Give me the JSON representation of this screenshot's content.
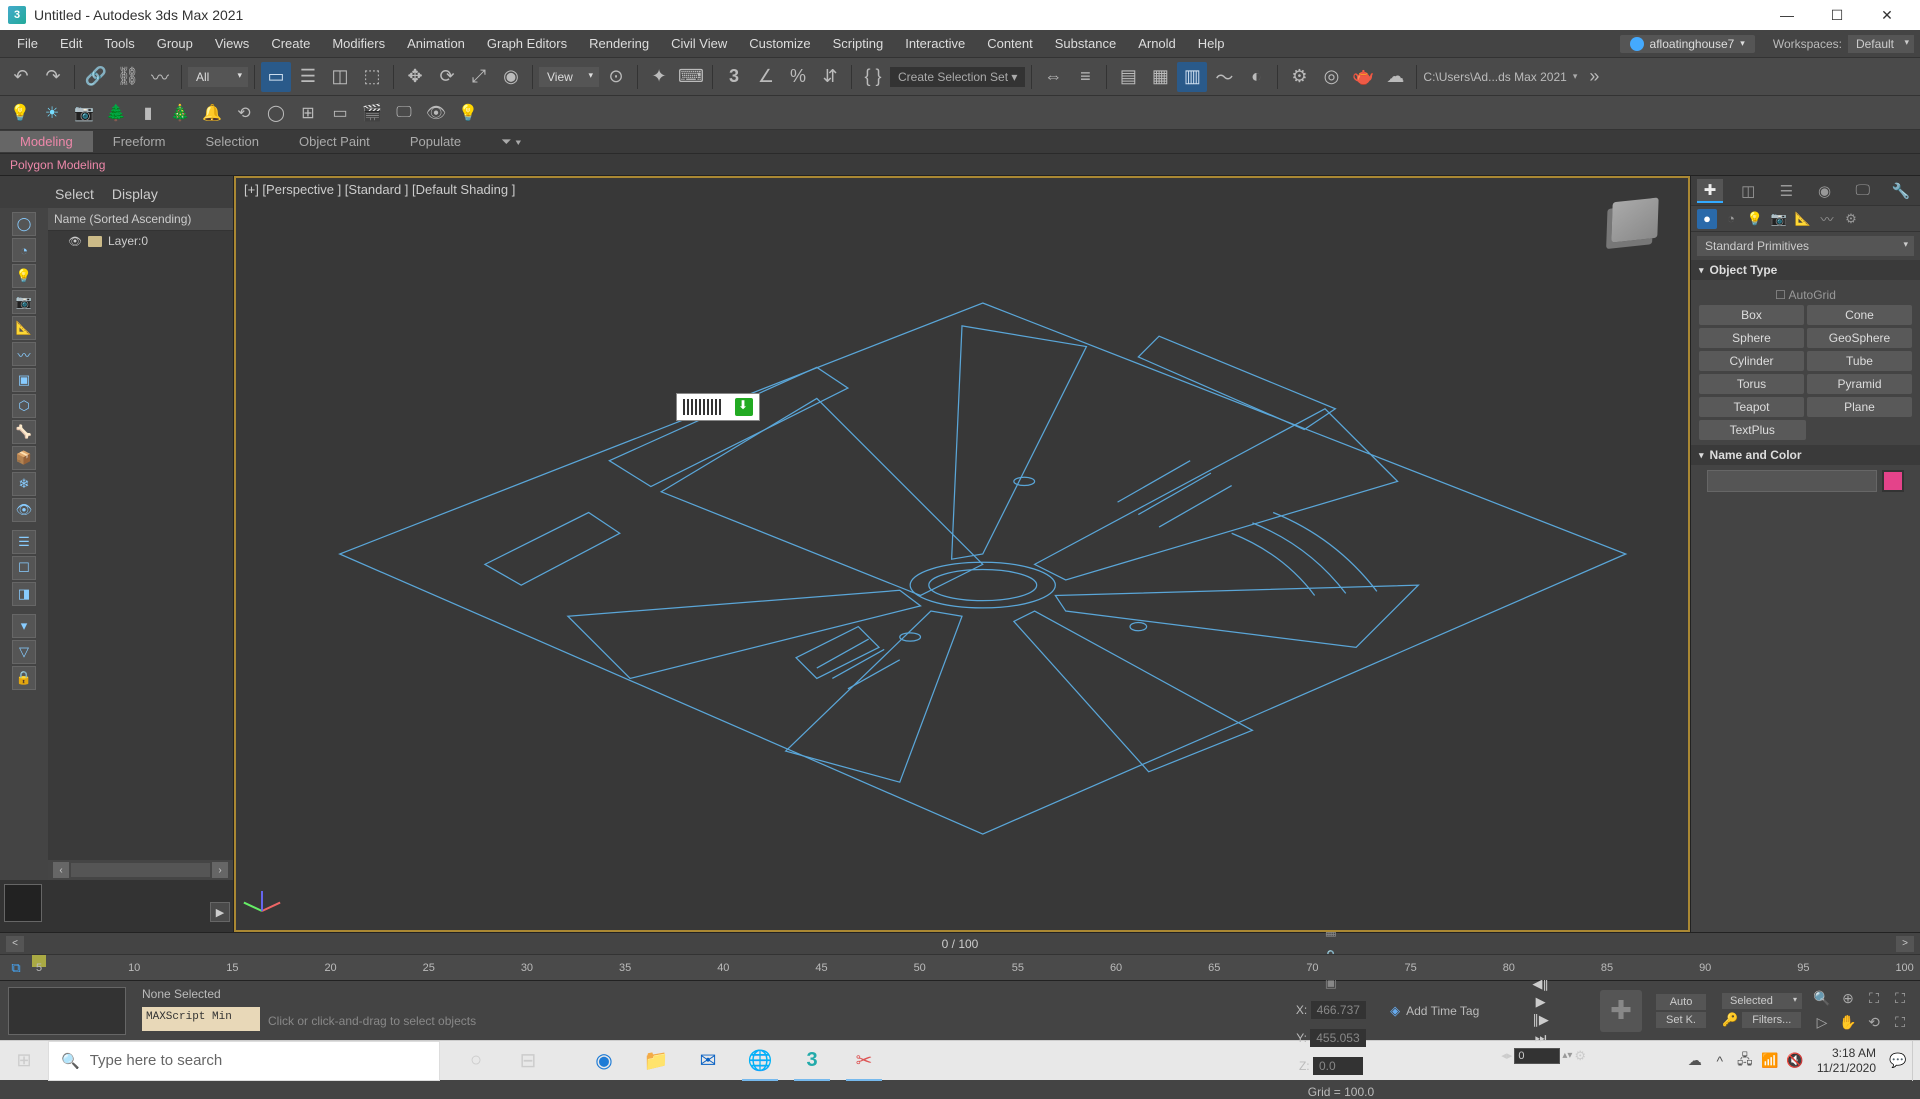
{
  "titlebar": {
    "title": "Untitled - Autodesk 3ds Max 2021"
  },
  "menu": {
    "items": [
      "File",
      "Edit",
      "Tools",
      "Group",
      "Views",
      "Create",
      "Modifiers",
      "Animation",
      "Graph Editors",
      "Rendering",
      "Civil View",
      "Customize",
      "Scripting",
      "Interactive",
      "Content",
      "Substance",
      "Arnold",
      "Help"
    ],
    "user": "afloatinghouse7",
    "workspaces_label": "Workspaces:",
    "workspace": "Default"
  },
  "toolbar": {
    "filter": "All",
    "refcoord": "View",
    "selset_placeholder": "Create Selection Set",
    "project_path": "C:\\Users\\Ad...ds Max 2021"
  },
  "ribbon": {
    "tabs": [
      "Modeling",
      "Freeform",
      "Selection",
      "Object Paint",
      "Populate"
    ],
    "sub": "Polygon Modeling"
  },
  "scene": {
    "tabs": [
      "Select",
      "Display"
    ],
    "header": "Name (Sorted Ascending)",
    "layer0": "Layer:0"
  },
  "viewport": {
    "label": "[+] [Perspective ] [Standard ] [Default Shading ]"
  },
  "cmdpanel": {
    "category": "Standard Primitives",
    "rollout_objtype": "Object Type",
    "autogrid": "AutoGrid",
    "buttons": [
      "Box",
      "Cone",
      "Sphere",
      "GeoSphere",
      "Cylinder",
      "Tube",
      "Torus",
      "Pyramid",
      "Teapot",
      "Plane",
      "TextPlus"
    ],
    "rollout_name": "Name and Color"
  },
  "time": {
    "frame": "0 / 100",
    "ticks": [
      "5",
      "10",
      "15",
      "20",
      "25",
      "30",
      "35",
      "40",
      "45",
      "50",
      "55",
      "60",
      "65",
      "70",
      "75",
      "80",
      "85",
      "90",
      "95",
      "100"
    ]
  },
  "status": {
    "sel": "None Selected",
    "prompt": "Click or click-and-drag to select objects",
    "maxscript": "MAXScript Min",
    "x": "466.737",
    "y": "455.053",
    "z": "0.0",
    "grid": "Grid = 100.0",
    "addtag": "Add Time Tag",
    "autokey": "Auto",
    "setkey": "Set K.",
    "keyfilters": "Filters...",
    "keymode": "Selected",
    "frameval": "0"
  },
  "taskbar": {
    "search_placeholder": "Type here to search",
    "time": "3:18 AM",
    "date": "11/21/2020"
  }
}
